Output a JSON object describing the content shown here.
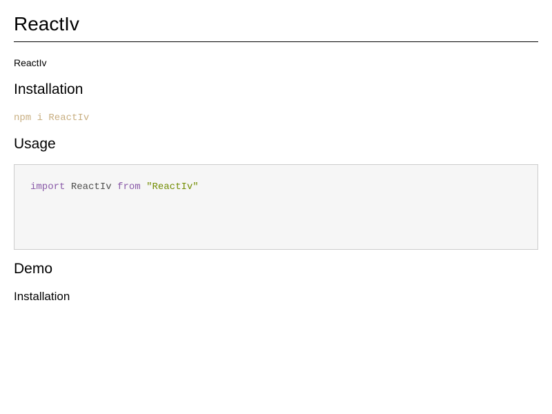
{
  "document": {
    "title": "ReactIv",
    "intro": "ReactIv",
    "sections": {
      "installation": {
        "heading": "Installation",
        "command": "npm i ReactIv"
      },
      "usage": {
        "heading": "Usage",
        "code": {
          "keyword_import": "import",
          "identifier": "ReactIv",
          "keyword_from": "from",
          "string": "\"ReactIv\""
        }
      },
      "demo": {
        "heading": "Demo",
        "subheading": "Installation"
      }
    }
  },
  "colors": {
    "keyword": "#8959a8",
    "identifier": "#4d4d4c",
    "string": "#718c00",
    "inline_command": "#c8ae80",
    "code_background": "#f6f6f6",
    "code_border": "#cccccc"
  }
}
